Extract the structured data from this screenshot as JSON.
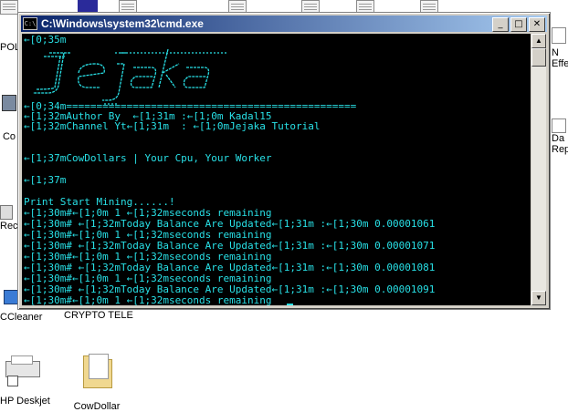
{
  "window": {
    "title": "C:\\Windows\\system32\\cmd.exe",
    "min_label": "_",
    "max_label": "□",
    "close_label": "✕"
  },
  "console": {
    "color": "#28e0e6",
    "lines": [
      "←[0;35m",
      "←[0;34m================================================",
      "←[1;32mAuthor By  ←[1;31m :←[1;0m Kadal15",
      "←[1;32mChannel Yt←[1;31m  : ←[1;0mJejaka Tutorial",
      "←[1;37mCowDollars | Your Cpu, Your Worker",
      "←[1;37m",
      "Print Start Mining......!",
      "←[1;30m#←[1;0m 1 ←[1;32mseconds remaining",
      "←[1;30m# ←[1;32mToday Balance Are Updated←[1;31m :←[1;30m 0.00001061",
      "←[1;30m#←[1;0m 1 ←[1;32mseconds remaining",
      "←[1;30m# ←[1;32mToday Balance Are Updated←[1;31m :←[1;30m 0.00001071",
      "←[1;30m#←[1;0m 1 ←[1;32mseconds remaining",
      "←[1;30m# ←[1;32mToday Balance Are Updated←[1;31m :←[1;30m 0.00001081",
      "←[1;30m#←[1;0m 1 ←[1;32mseconds remaining",
      "←[1;30m# ←[1;32mToday Balance Are Updated←[1;31m :←[1;30m 0.00001091",
      "←[1;30m#←[1;0m 1 ←[1;32mseconds remaining"
    ]
  },
  "banner_art": {
    "text": "Jejaka",
    "icon": "ascii-art-logo"
  },
  "desktop": {
    "icons": [
      {
        "label": "POL",
        "icon": "folder-icon"
      },
      {
        "label": "Co",
        "icon": "computer-icon"
      },
      {
        "label": "Rec",
        "icon": "recycle-bin-icon"
      },
      {
        "label": "CCleaner",
        "icon": "ccleaner-icon"
      },
      {
        "label": "CRYPTO TELE",
        "icon": "app-icon"
      },
      {
        "label": "HP Deskjet",
        "icon": "printer-icon"
      },
      {
        "label": "CowDollar",
        "icon": "folder-icon"
      },
      {
        "label": "N",
        "icon": "document-icon"
      },
      {
        "label": "Effe",
        "icon": "document-icon"
      },
      {
        "label": "Da",
        "icon": "document-icon"
      },
      {
        "label": "Rep",
        "icon": "document-icon"
      }
    ]
  }
}
